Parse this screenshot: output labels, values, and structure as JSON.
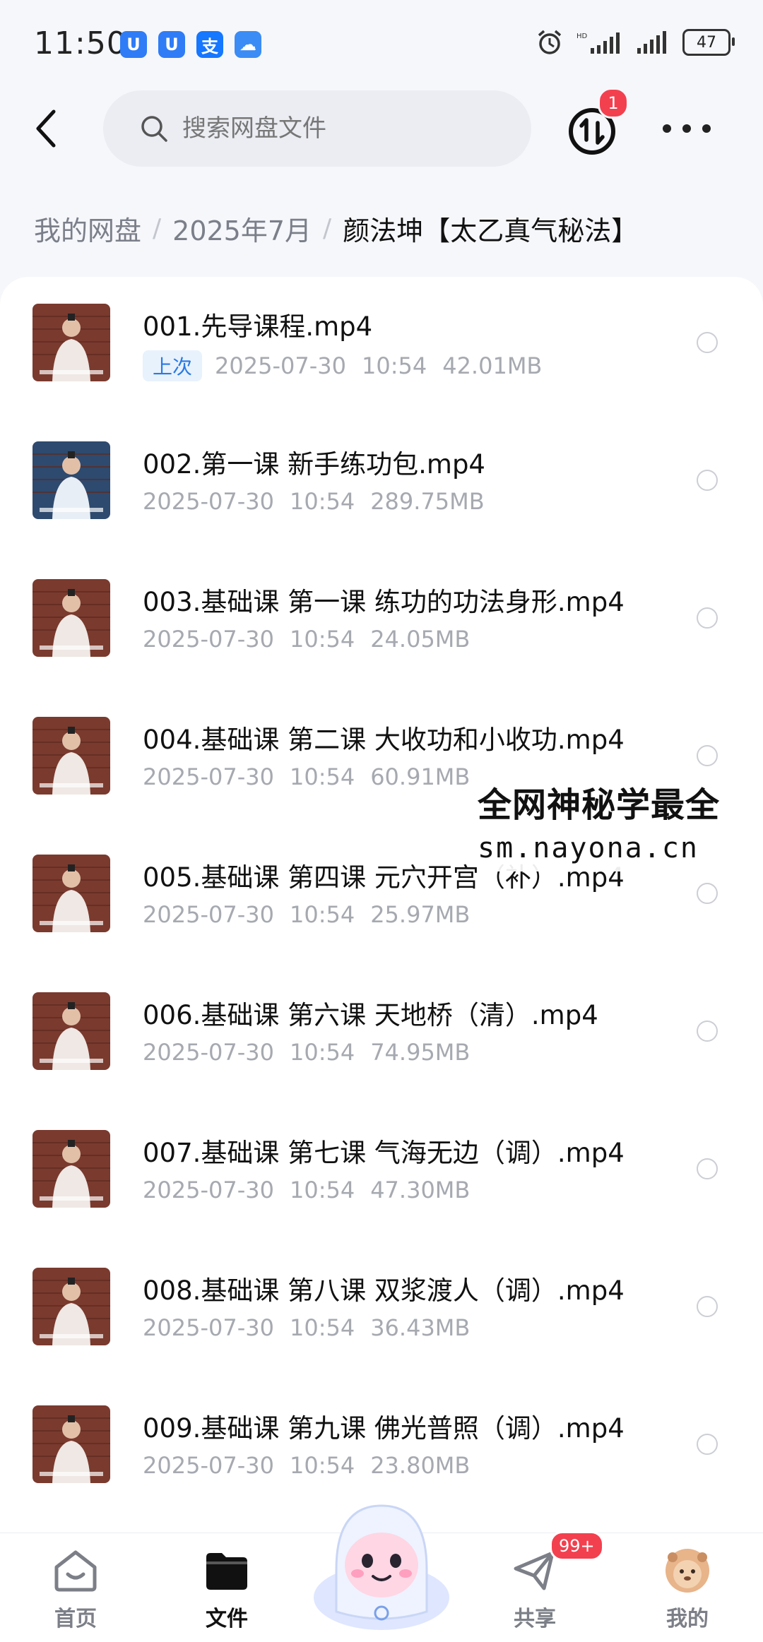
{
  "status_bar": {
    "time": "11:50",
    "apps": [
      {
        "name": "baidu-netdisk-icon",
        "glyph": "U",
        "color": "#2f7cf6"
      },
      {
        "name": "baidu-netdisk-icon-2",
        "glyph": "U",
        "color": "#2f7cf6"
      },
      {
        "name": "alipay-icon",
        "glyph": "支",
        "color": "#1677ff"
      },
      {
        "name": "weather-icon",
        "glyph": "☁",
        "color": "#3b8cf5"
      }
    ],
    "battery": "47"
  },
  "search": {
    "placeholder": "搜索网盘文件"
  },
  "transfer_badge": "1",
  "breadcrumb": {
    "root": "我的网盘",
    "folder": "2025年7月",
    "current": "颜法坤【太乙真气秘法】"
  },
  "files": [
    {
      "name": "001.先导课程.mp4",
      "tag": "上次",
      "date": "2025-07-30",
      "time": "10:54",
      "size": "42.01MB"
    },
    {
      "name": "002.第一课 新手练功包.mp4",
      "date": "2025-07-30",
      "time": "10:54",
      "size": "289.75MB"
    },
    {
      "name": "003.基础课 第一课 练功的功法身形.mp4",
      "date": "2025-07-30",
      "time": "10:54",
      "size": "24.05MB"
    },
    {
      "name": "004.基础课 第二课 大收功和小收功.mp4",
      "date": "2025-07-30",
      "time": "10:54",
      "size": "60.91MB"
    },
    {
      "name": "005.基础课 第四课 元穴开宫（补）.mp4",
      "date": "2025-07-30",
      "time": "10:54",
      "size": "25.97MB"
    },
    {
      "name": "006.基础课 第六课 天地桥（清）.mp4",
      "date": "2025-07-30",
      "time": "10:54",
      "size": "74.95MB"
    },
    {
      "name": "007.基础课 第七课 气海无边（调）.mp4",
      "date": "2025-07-30",
      "time": "10:54",
      "size": "47.30MB"
    },
    {
      "name": "008.基础课 第八课 双浆渡人（调）.mp4",
      "date": "2025-07-30",
      "time": "10:54",
      "size": "36.43MB"
    },
    {
      "name": "009.基础课 第九课 佛光普照（调）.mp4",
      "date": "2025-07-30",
      "time": "10:54",
      "size": "23.80MB"
    }
  ],
  "watermark": {
    "line1": "全网神秘学最全",
    "line2": "sm.nayona.cn"
  },
  "nav": {
    "home": "首页",
    "files": "文件",
    "share": "共享",
    "share_badge": "99+",
    "mine": "我的"
  },
  "colors": {
    "accent": "#2a7ae4",
    "badge": "#f2404f"
  }
}
